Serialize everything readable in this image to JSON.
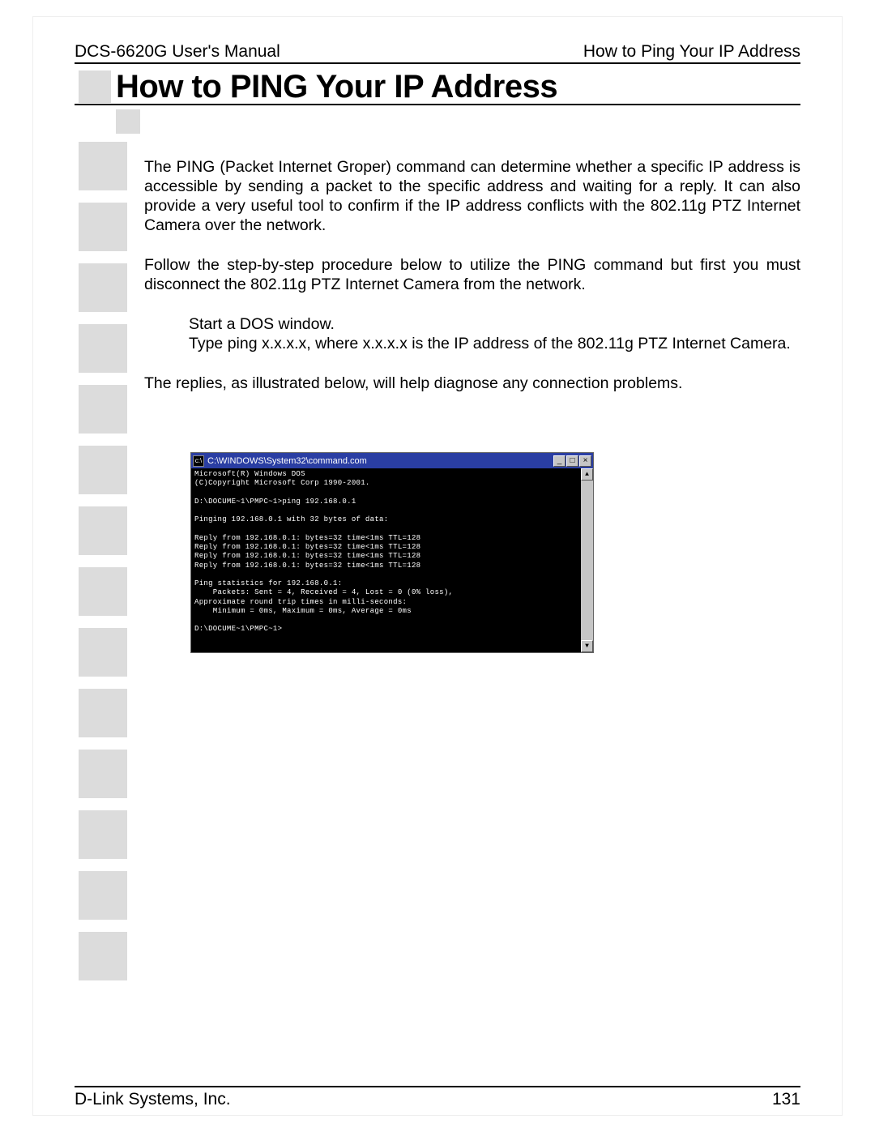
{
  "header": {
    "left": "DCS-6620G User's Manual",
    "right": "How to Ping Your IP Address"
  },
  "title": "How to PING Your IP Address",
  "paragraphs": {
    "p1": "The PING (Packet Internet Groper) command can determine whether a specific IP address is accessible by sending a packet to the specific address and waiting for a reply. It can also provide a very useful tool to confirm if the IP address conflicts with the 802.11g PTZ Internet Camera over the network.",
    "p2": "Follow the step-by-step procedure below to utilize the PING command but first you must disconnect the 802.11g PTZ Internet Camera from the network.",
    "p3a": "Start a DOS window.",
    "p3b": "Type ping x.x.x.x, where x.x.x.x is the IP address of the 802.11g PTZ Internet Camera.",
    "p4": "The replies, as illustrated below, will help diagnose any connection problems."
  },
  "dos": {
    "title": "C:\\WINDOWS\\System32\\command.com",
    "min": "_",
    "max": "□",
    "close": "×",
    "up": "▲",
    "down": "▼",
    "content": "Microsoft(R) Windows DOS\n(C)Copyright Microsoft Corp 1990-2001.\n\nD:\\DOCUME~1\\PMPC~1>ping 192.168.0.1\n\nPinging 192.168.0.1 with 32 bytes of data:\n\nReply from 192.168.0.1: bytes=32 time<1ms TTL=128\nReply from 192.168.0.1: bytes=32 time<1ms TTL=128\nReply from 192.168.0.1: bytes=32 time<1ms TTL=128\nReply from 192.168.0.1: bytes=32 time<1ms TTL=128\n\nPing statistics for 192.168.0.1:\n    Packets: Sent = 4, Received = 4, Lost = 0 (0% loss),\nApproximate round trip times in milli-seconds:\n    Minimum = 0ms, Maximum = 0ms, Average = 0ms\n\nD:\\DOCUME~1\\PMPC~1>"
  },
  "footer": {
    "company": "D-Link Systems, Inc.",
    "page": "131"
  }
}
